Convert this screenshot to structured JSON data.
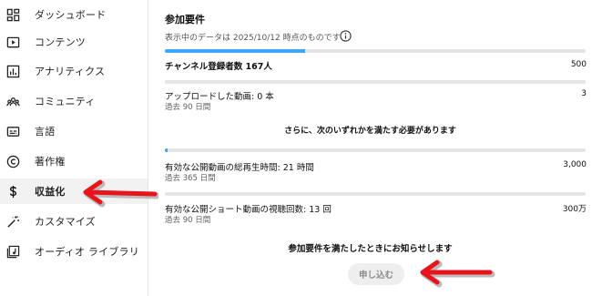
{
  "sidebar": {
    "items": [
      {
        "label": "ダッシュボード",
        "icon": "dashboard-icon"
      },
      {
        "label": "コンテンツ",
        "icon": "content-icon"
      },
      {
        "label": "アナリティクス",
        "icon": "analytics-icon"
      },
      {
        "label": "コミュニティ",
        "icon": "community-icon"
      },
      {
        "label": "言語",
        "icon": "subtitles-icon"
      },
      {
        "label": "著作権",
        "icon": "copyright-icon"
      },
      {
        "label": "収益化",
        "icon": "dollar-icon",
        "active": true
      },
      {
        "label": "カスタマイズ",
        "icon": "magic-wand-icon"
      },
      {
        "label": "オーディオ ライブラリ",
        "icon": "audio-library-icon"
      }
    ]
  },
  "main": {
    "title": "参加要件",
    "data_note": "表示中のデータは 2025/10/12 時点のものです",
    "subscribers": {
      "label": "チャンネル登録者数 167人",
      "target": "500",
      "progress": 0.334
    },
    "uploads": {
      "label": "アップロードした動画: 0 本",
      "sub": "過去 90 日間",
      "target": "3",
      "progress": 0.0
    },
    "either_note": "さらに、次のいずれかを満たす必要があります",
    "watch_hours": {
      "label": "有効な公開動画の総再生時間: 21 時間",
      "sub": "過去 365 日間",
      "target": "3,000",
      "progress": 0.007
    },
    "shorts_views": {
      "label": "有効な公開ショート動画の視聴回数: 13 回",
      "sub": "過去 90 日間",
      "target": "300万",
      "progress": 0.0
    },
    "notify_text": "参加要件を満たしたときにお知らせします",
    "apply_button": "申し込む"
  },
  "colors": {
    "progress": "#3ea6ff",
    "track": "#e5e5e5",
    "annotation_arrow": "#e8141c"
  }
}
